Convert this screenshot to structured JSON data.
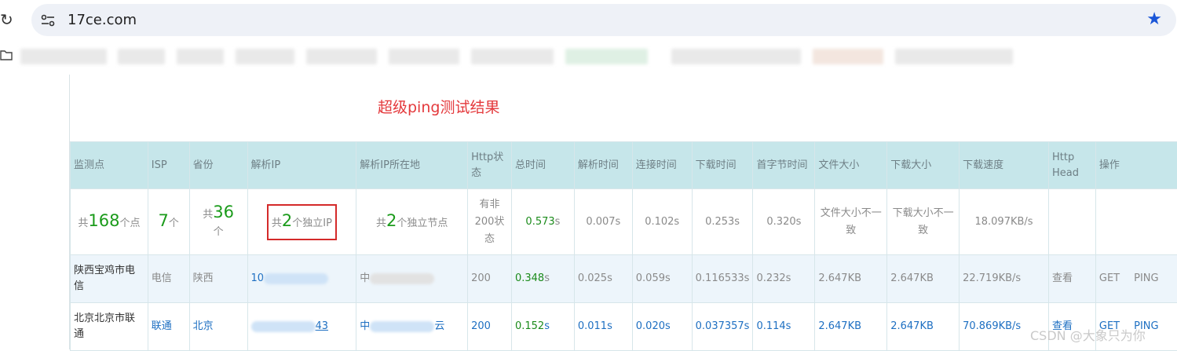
{
  "browser": {
    "url": "17ce.com",
    "icons": {
      "reload": "reload-icon",
      "site": "site-settings-icon",
      "star": "bookmark-star-icon",
      "folder": "folder-icon"
    }
  },
  "page": {
    "title": "超级ping测试结果"
  },
  "table": {
    "headers": [
      "监测点",
      "ISP",
      "省份",
      "解析IP",
      "解析IP所在地",
      "Http状态",
      "总时间",
      "解析时间",
      "连接时间",
      "下载时间",
      "首字节时间",
      "文件大小",
      "下载大小",
      "下载速度",
      "Http Head",
      "操作"
    ],
    "summary": {
      "points_prefix": "共",
      "points_count": "168",
      "points_suffix": "个点",
      "isp_count": "7",
      "isp_suffix": "个",
      "province_prefix": "共",
      "province_count": "36",
      "province_suffix": "个",
      "ip_prefix": "共",
      "ip_count": "2",
      "ip_suffix": "个独立IP",
      "node_prefix": "共",
      "node_count": "2",
      "node_suffix": "个独立节点",
      "http_status": "有非200状态",
      "total_time_value": "0.573",
      "total_time_unit": "s",
      "dns_time": "0.007s",
      "connect_time": "0.102s",
      "download_time": "0.253s",
      "first_byte_time": "0.320s",
      "file_size": "文件大小不一致",
      "download_size": "下载大小不一致",
      "speed": "18.097KB/s"
    },
    "rows": [
      {
        "location": "陕西宝鸡市电信",
        "isp": "电信",
        "province": "陕西",
        "ip_visible": "10",
        "ip_location_visible": "中",
        "http_status": "200",
        "total_time_value": "0.348",
        "total_time_unit": "s",
        "dns_time": "0.025s",
        "connect_time": "0.059s",
        "download_time": "0.116533s",
        "first_byte_time": "0.232s",
        "file_size": "2.647KB",
        "download_size": "2.647KB",
        "speed": "22.719KB/s",
        "head": "查看",
        "op_get": "GET",
        "op_ping": "PING"
      },
      {
        "location": "北京北京市联通",
        "isp": "联通",
        "province": "北京",
        "ip_visible": "43",
        "ip_location_visible": "中",
        "ip_location_tail": "云",
        "http_status": "200",
        "total_time_value": "0.152",
        "total_time_unit": "s",
        "dns_time": "0.011s",
        "connect_time": "0.020s",
        "download_time": "0.037357s",
        "first_byte_time": "0.114s",
        "file_size": "2.647KB",
        "download_size": "2.647KB",
        "speed": "70.869KB/s",
        "head": "查看",
        "op_get": "GET",
        "op_ping": "PING"
      }
    ]
  },
  "watermark": "CSDN @大象只为你",
  "colors": {
    "accent_red": "#e4393c",
    "header_bg": "#c6e6ea",
    "link_blue": "#1d6fc2",
    "success_green": "#1b9b1b"
  }
}
